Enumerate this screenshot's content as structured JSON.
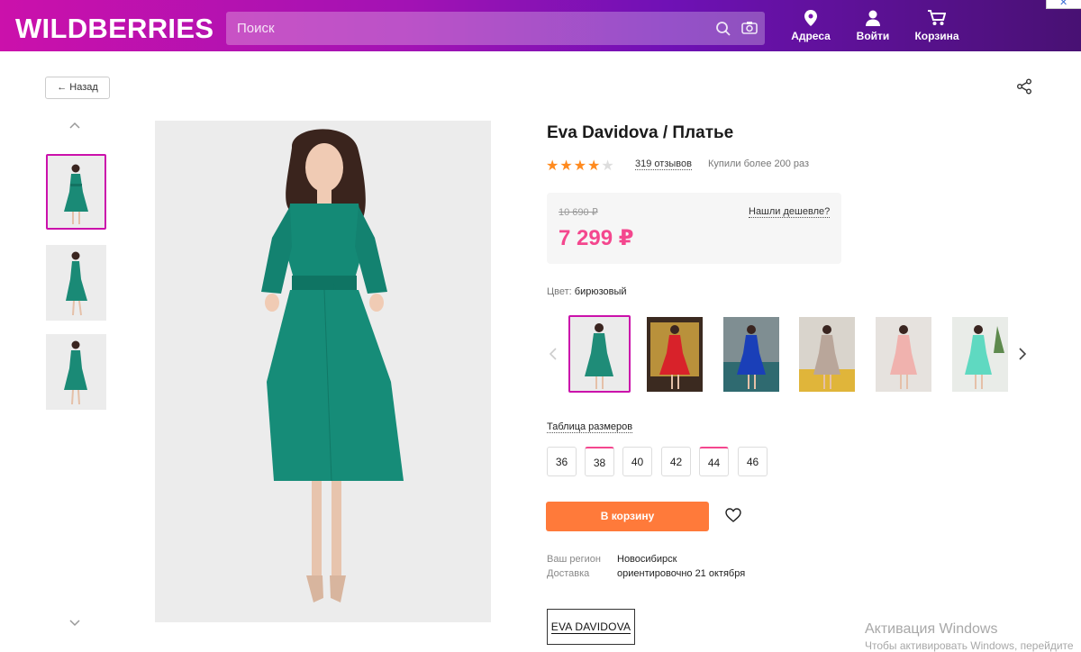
{
  "header": {
    "logo": "WILDBERRIES",
    "search_placeholder": "Поиск",
    "nav": [
      {
        "label": "Адреса",
        "icon": "location-pin-icon"
      },
      {
        "label": "Войти",
        "icon": "user-icon"
      },
      {
        "label": "Корзина",
        "icon": "cart-icon"
      }
    ],
    "gradient": [
      "#cb11ab",
      "#481173"
    ]
  },
  "back_label": "← Назад",
  "product": {
    "title": "Eva Davidova / Платье",
    "rating": 4,
    "rating_max": 5,
    "reviews": "319 отзывов",
    "bought": "Купили более 200 раз",
    "old_price": "10 690 ₽",
    "price": "7 299 ₽",
    "cheaper_link": "Нашли дешевле?",
    "color_key": "Цвет:",
    "color_value": "бирюзовый",
    "variants": [
      {
        "color": "#1f8c78",
        "active": true
      },
      {
        "color": "#d8222a",
        "active": false
      },
      {
        "color": "#1a3fb8",
        "active": false
      },
      {
        "color": "#b9a69a",
        "active": false
      },
      {
        "color": "#f0b2ae",
        "active": false
      },
      {
        "color": "#5fd9c1",
        "active": false
      }
    ],
    "size_table_label": "Таблица размеров",
    "sizes": [
      {
        "label": "36",
        "marked": false
      },
      {
        "label": "38",
        "marked": true
      },
      {
        "label": "40",
        "marked": false
      },
      {
        "label": "42",
        "marked": false
      },
      {
        "label": "44",
        "marked": true
      },
      {
        "label": "46",
        "marked": false
      }
    ],
    "cart_button": "В корзину",
    "region_key": "Ваш регион",
    "region_value": "Новосибирск",
    "delivery_key": "Доставка",
    "delivery_value": "ориентировочно 21 октября",
    "brand": "EVA DAVIDOVA"
  },
  "colors": {
    "accent_pink": "#cb11ab",
    "price": "#f4478e",
    "cart_button": "#ff7a3a",
    "star": "#ff8a1e"
  },
  "watermark": {
    "line1": "Активация Windows",
    "line2": "Чтобы активировать Windows, перейдите"
  }
}
